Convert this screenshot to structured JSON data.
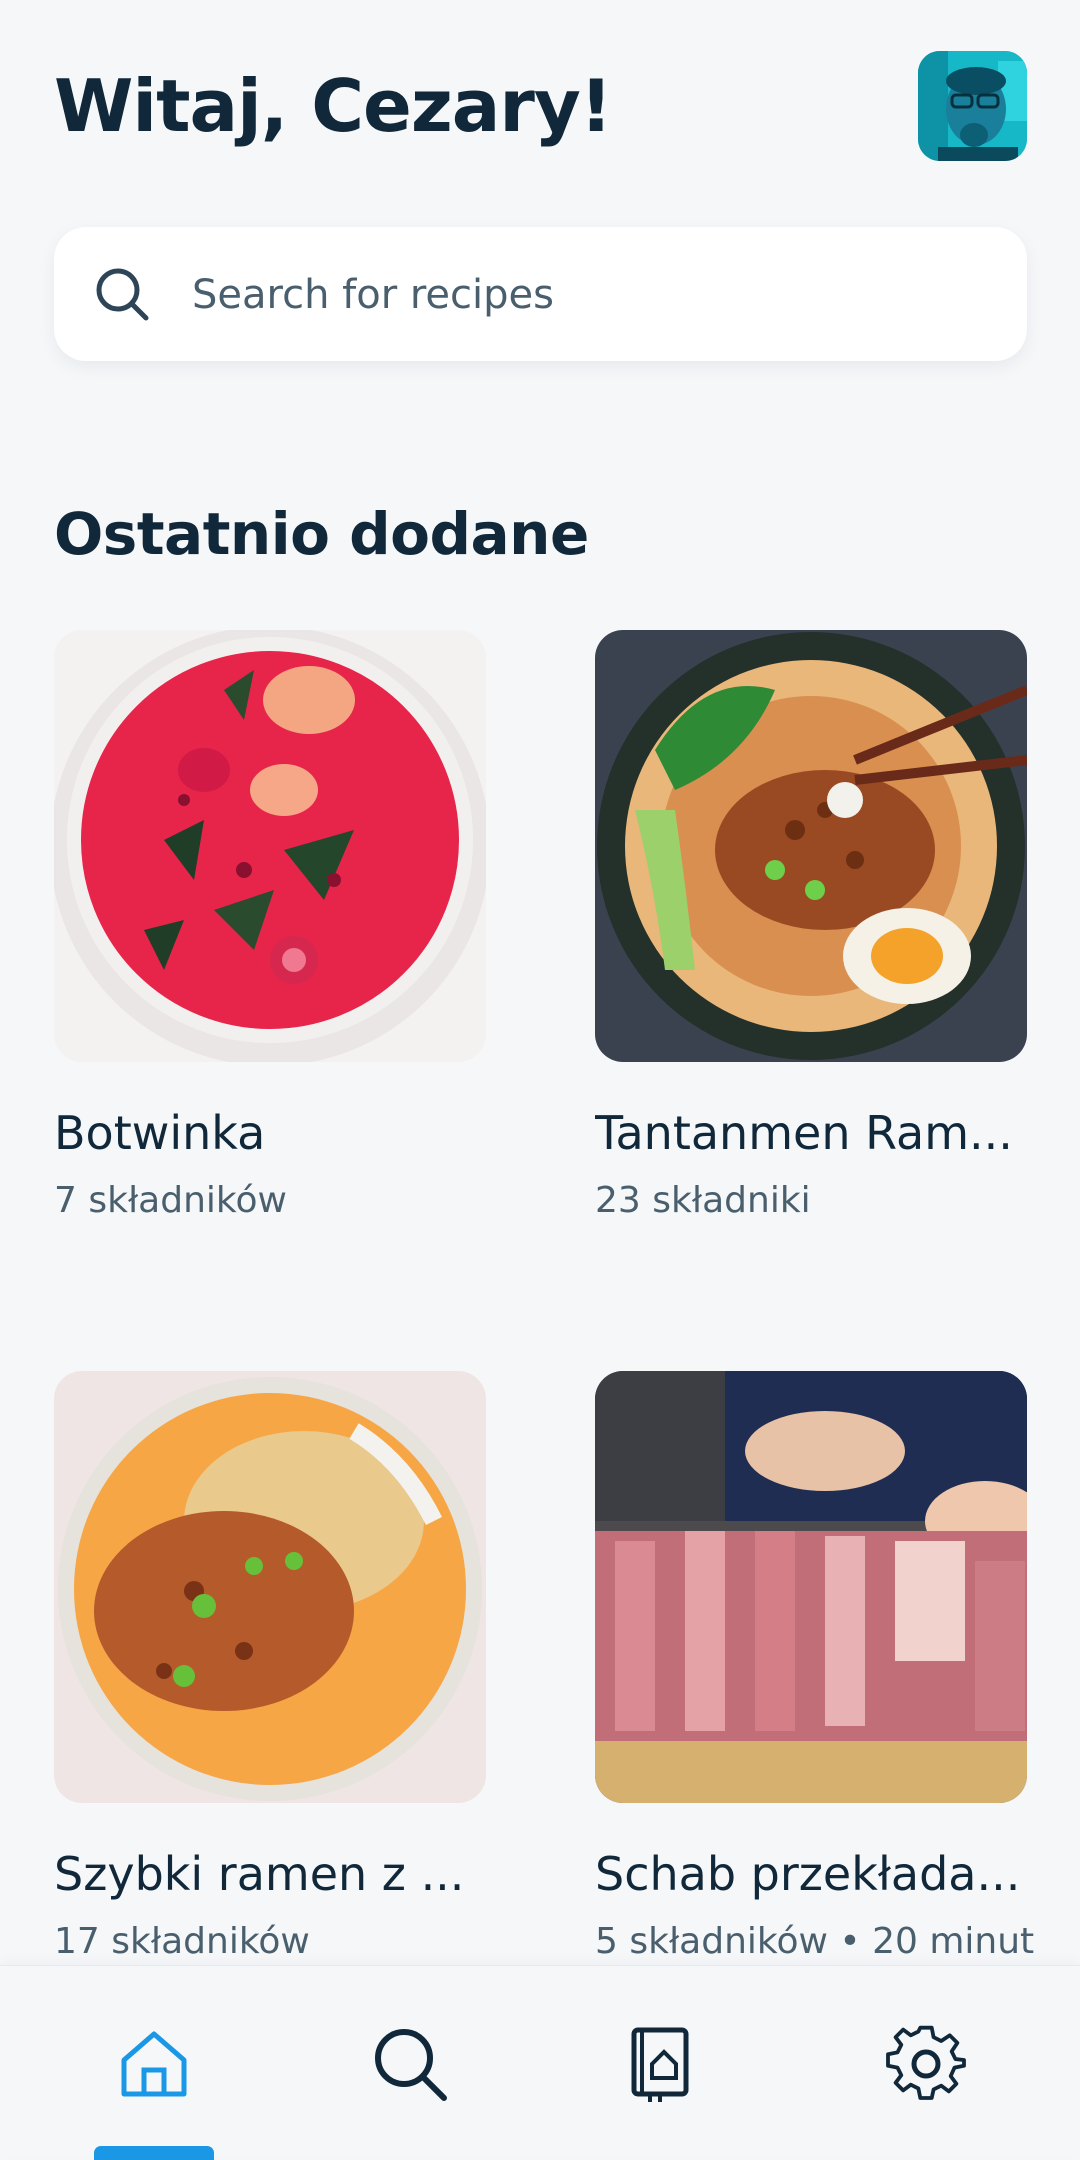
{
  "header": {
    "greeting": "Witaj, Cezary!"
  },
  "search": {
    "placeholder": "Search for recipes"
  },
  "section": {
    "title": "Ostatnio dodane"
  },
  "recipes": [
    {
      "title": "Botwinka",
      "meta": "7 składników"
    },
    {
      "title": "Tantanmen Ram...",
      "meta": "23 składniki"
    },
    {
      "title": "Szybki ramen z ...",
      "meta": "17 składników"
    },
    {
      "title": "Schab przekłada...",
      "meta": "5 składników • 20 minut"
    }
  ],
  "nav": {
    "items": [
      "home-icon",
      "search-icon",
      "recipe-book-icon",
      "gear-icon"
    ],
    "active": "home-icon"
  },
  "colors": {
    "accent": "#1a98e6",
    "text": "#10283a",
    "muted": "#4a5f6e",
    "background": "#f5f7f9"
  }
}
